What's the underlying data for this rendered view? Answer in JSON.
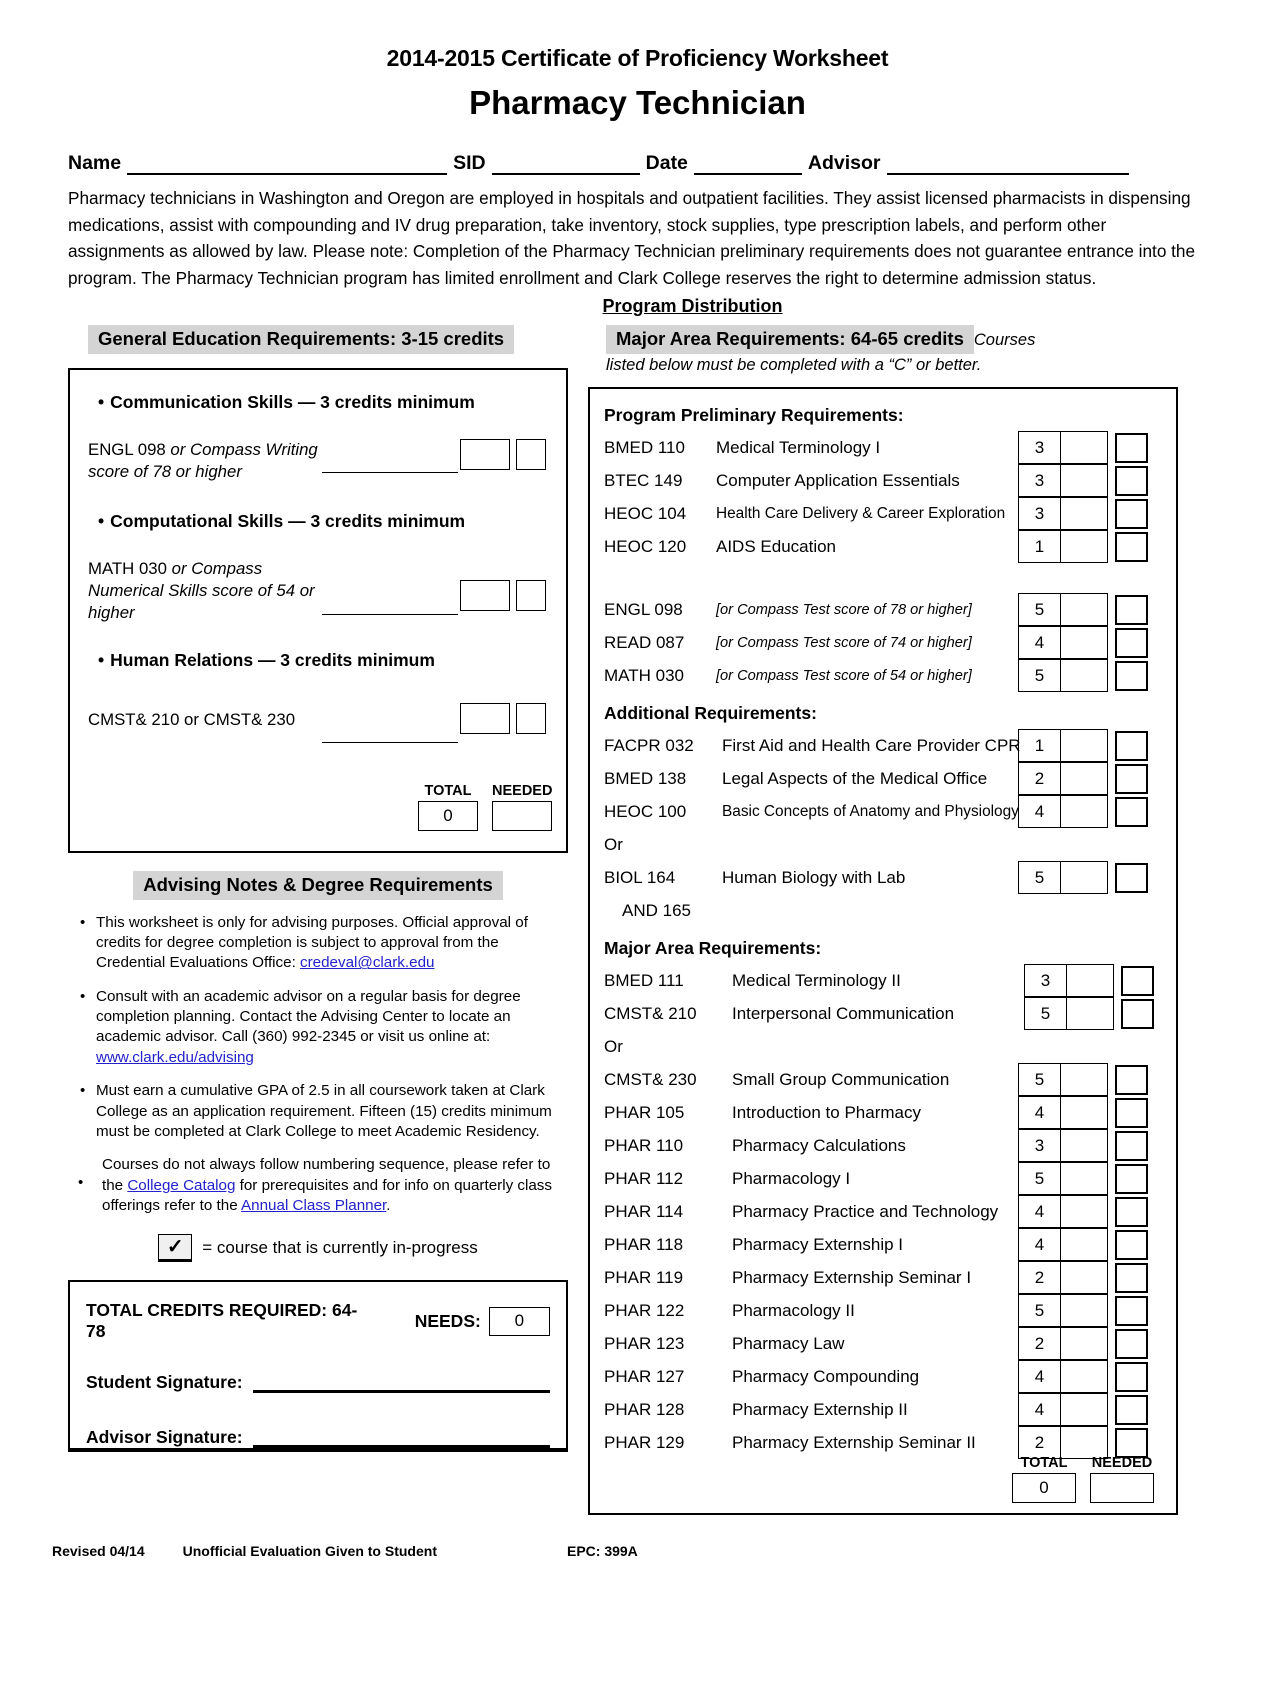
{
  "header": {
    "title_line1": "2014-2015 Certificate of Proficiency Worksheet",
    "title_line2": "Pharmacy Technician",
    "name_label": "Name",
    "sid_label": "SID",
    "date_label": "Date",
    "advisor_label": "Advisor"
  },
  "intro": "Pharmacy technicians in Washington and Oregon are employed in hospitals and outpatient facilities. They assist licensed pharmacists in dispensing medications, assist with compounding and IV drug preparation, take inventory, stock supplies, type prescription labels, and perform other assignments as allowed by law. Please note: Completion of the Pharmacy Technician preliminary requirements does not guarantee entrance into the program. The Pharmacy Technician program has limited enrollment and Clark College reserves the right to determine admission status.",
  "program_distribution_label": "Program Distribution",
  "general_education": {
    "heading": "General Education Requirements: 3-15 credits",
    "groups": [
      {
        "bullet": "Communication Skills — 3 credits minimum",
        "course_line1": "ENGL 098",
        "course_italic1": " or Compass Writing",
        "course_italic2": "score of 78 or higher"
      },
      {
        "bullet": "Computational Skills — 3 credits minimum",
        "course_line1": "MATH 030",
        "course_italic1": " or Compass",
        "course_italic2": "Numerical Skills  score of 54 or",
        "course_italic3": "higher"
      },
      {
        "bullet": "Human Relations — 3 credits minimum",
        "course_line1": "CMST& 210 or CMST& 230"
      }
    ],
    "total_label": "TOTAL",
    "needed_label": "NEEDED",
    "total_value": "0",
    "needed_value": ""
  },
  "advising": {
    "heading": "Advising Notes & Degree Requirements",
    "notes": [
      {
        "text_before": "This worksheet is only for advising purposes. Official approval of credits for degree completion is subject to approval from the Credential Evaluations Office: ",
        "link": "credeval@clark.edu",
        "text_after": ""
      },
      {
        "text_before": "Consult with an academic advisor on a regular basis for degree completion planning. Contact the Advising Center to locate an academic advisor. Call (360) 992-2345 or visit us online at: ",
        "link": "www.clark.edu/advising",
        "text_after": ""
      },
      {
        "text_before": "Must earn a cumulative GPA of 2.5 in all coursework taken at Clark College as an application requirement. Fifteen (15) credits minimum must be completed at Clark College to meet Academic Residency.",
        "link": "",
        "text_after": ""
      },
      {
        "text_before": "Courses do not always follow numbering sequence, please refer to the ",
        "link": "College Catalog",
        "text_mid": " for prerequisites and for info on quarterly class offerings refer to the ",
        "link2": "Annual Class Planner",
        "text_after": "."
      }
    ],
    "legend_check": "✓",
    "legend_text": "= course that is currently in-progress"
  },
  "credits_box": {
    "total_required_label": "TOTAL CREDITS REQUIRED: 64-78",
    "needs_label": "NEEDS:",
    "needs_value": "0",
    "student_signature_label": "Student Signature:",
    "advisor_signature_label": "Advisor Signature:"
  },
  "major_area": {
    "heading": "Major Area Requirements: 64-65 credits",
    "heading_italic": "Courses",
    "heading_italic2": "listed below must be completed with a “C” or better.",
    "preliminary_heading": "Program Preliminary Requirements:",
    "preliminary": [
      {
        "code": "BMED 110",
        "desc": "Medical Terminology I",
        "credits": "3",
        "size": "normal"
      },
      {
        "code": "BTEC 149",
        "desc": "Computer Application Essentials",
        "credits": "3",
        "size": "normal"
      },
      {
        "code": "HEOC 104",
        "desc": "Health Care Delivery & Career Exploration",
        "credits": "3",
        "size": "small"
      },
      {
        "code": "HEOC 120",
        "desc": "AIDS Education",
        "credits": "1",
        "size": "normal"
      }
    ],
    "compass": [
      {
        "code": "ENGL 098",
        "desc": "[or Compass Test score of 78 or higher]",
        "credits": "5",
        "size": "italic"
      },
      {
        "code": "READ 087",
        "desc": "[or Compass Test score of 74 or higher]",
        "credits": "4",
        "size": "italic"
      },
      {
        "code": "MATH 030",
        "desc": "[or Compass Test score of 54 or higher]",
        "credits": "5",
        "size": "italic"
      }
    ],
    "additional_heading": "Additional Requirements:",
    "additional": [
      {
        "code": "FACPR 032",
        "desc": "First Aid and Health Care Provider CPR",
        "credits": "1",
        "size": "normal"
      },
      {
        "code": "BMED 138",
        "desc": "Legal Aspects of the Medical Office",
        "credits": "2",
        "size": "normal"
      },
      {
        "code": "HEOC 100",
        "desc": "Basic Concepts of Anatomy and Physiology",
        "credits": "4",
        "size": "small"
      }
    ],
    "or_word": "Or",
    "biol": {
      "code": "BIOL 164",
      "desc": "Human Biology with Lab",
      "credits": "5"
    },
    "biol_and": "AND 165",
    "major_heading": "Major Area Requirements:",
    "major_first": [
      {
        "code": "BMED 111",
        "desc": "Medical Terminology II",
        "credits": "3"
      },
      {
        "code": "CMST& 210",
        "desc": "Interpersonal Communication",
        "credits": "5"
      }
    ],
    "or_word2": "Or",
    "major_rest": [
      {
        "code": "CMST& 230",
        "desc": "Small Group Communication",
        "credits": "5"
      },
      {
        "code": "PHAR 105",
        "desc": "Introduction to Pharmacy",
        "credits": "4"
      },
      {
        "code": "PHAR 110",
        "desc": "Pharmacy Calculations",
        "credits": "3"
      },
      {
        "code": "PHAR 112",
        "desc": "Pharmacology I",
        "credits": "5"
      },
      {
        "code": "PHAR 114",
        "desc": "Pharmacy Practice and Technology",
        "credits": "4"
      },
      {
        "code": "PHAR 118",
        "desc": "Pharmacy Externship I",
        "credits": "4"
      },
      {
        "code": "PHAR 119",
        "desc": "Pharmacy Externship Seminar I",
        "credits": "2"
      },
      {
        "code": "PHAR 122",
        "desc": "Pharmacology II",
        "credits": "5"
      },
      {
        "code": "PHAR 123",
        "desc": "Pharmacy Law",
        "credits": "2"
      },
      {
        "code": "PHAR 127",
        "desc": "Pharmacy Compounding",
        "credits": "4"
      },
      {
        "code": "PHAR 128",
        "desc": "Pharmacy Externship II",
        "credits": "4"
      },
      {
        "code": "PHAR 129",
        "desc": "Pharmacy Externship Seminar II",
        "credits": "2"
      }
    ],
    "total_label": "TOTAL",
    "needed_label": "NEEDED",
    "total_value": "0",
    "needed_value": ""
  },
  "footer": {
    "revised": "Revised 04/14",
    "unofficial": "Unofficial Evaluation Given to Student",
    "epc": "EPC: 399A"
  }
}
